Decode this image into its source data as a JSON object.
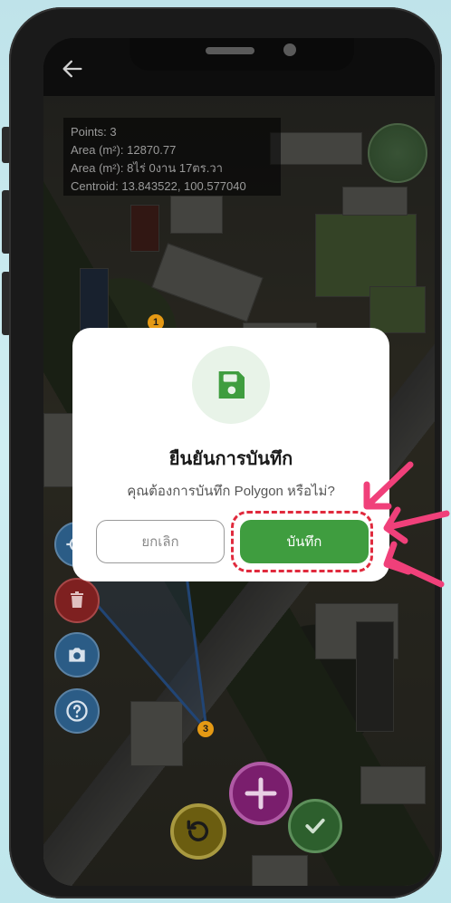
{
  "map_info": {
    "points": "Points: 3",
    "area_m2": "Area (m²): 12870.77",
    "area_thai": "Area (m²): 8ไร่ 0งาน 17ตร.วา",
    "centroid": "Centroid: 13.843522, 100.577040"
  },
  "markers": [
    "1",
    "3"
  ],
  "dialog": {
    "title": "ยืนยันการบันทึก",
    "message": "คุณต้องการบันทึก Polygon หรือไม่?",
    "cancel_label": "ยกเลิก",
    "confirm_label": "บันทึก",
    "icon": "save-icon"
  },
  "colors": {
    "accent_green": "#3f9d3f",
    "highlight_red": "#e02a3d",
    "arrow_pink": "#f0407a"
  },
  "icons": [
    "back-arrow-icon",
    "locate-icon",
    "trash-icon",
    "camera-icon",
    "help-icon",
    "plus-icon",
    "undo-icon",
    "check-icon"
  ]
}
